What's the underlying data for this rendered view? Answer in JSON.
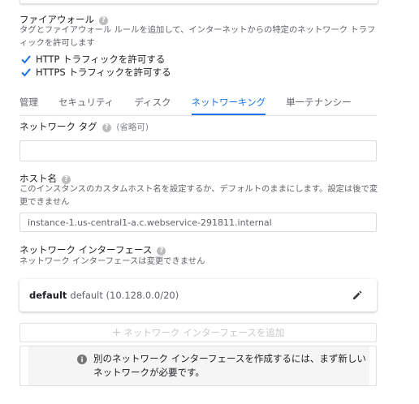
{
  "firewall": {
    "title": "ファイアウォール",
    "description": "タグとファイアウォール ルールを追加して、インターネットからの特定のネットワーク トラフィックを許可します",
    "http_label": "HTTP トラフィックを許可する",
    "https_label": "HTTPS トラフィックを許可する",
    "http_checked": true,
    "https_checked": true
  },
  "tabs": [
    {
      "label": "管理"
    },
    {
      "label": "セキュリティ"
    },
    {
      "label": "ディスク"
    },
    {
      "label": "ネットワーキング"
    },
    {
      "label": "単一テナンシー"
    }
  ],
  "active_tab": "ネットワーキング",
  "network_tags": {
    "label": "ネットワーク タグ",
    "optional": "(省略可)",
    "value": ""
  },
  "hostname": {
    "label": "ホスト名",
    "description": "このインスタンスのカスタムホスト名を設定するか、デフォルトのままにします。設定は後で変更できません",
    "value": "instance-1.us-central1-a.c.webservice-291811.internal"
  },
  "network_interface": {
    "label": "ネットワーク インターフェース",
    "description": "ネットワーク インターフェースは変更できません",
    "name": "default",
    "detail": "default (10.128.0.0/20)",
    "add_button": "ネットワーク インターフェースを追加"
  },
  "info": {
    "message": "別のネットワーク インターフェースを作成するには、まず新しいネットワークが必要です。"
  },
  "colors": {
    "accent": "#1a73e8",
    "checkbox": "#1a73e8"
  }
}
